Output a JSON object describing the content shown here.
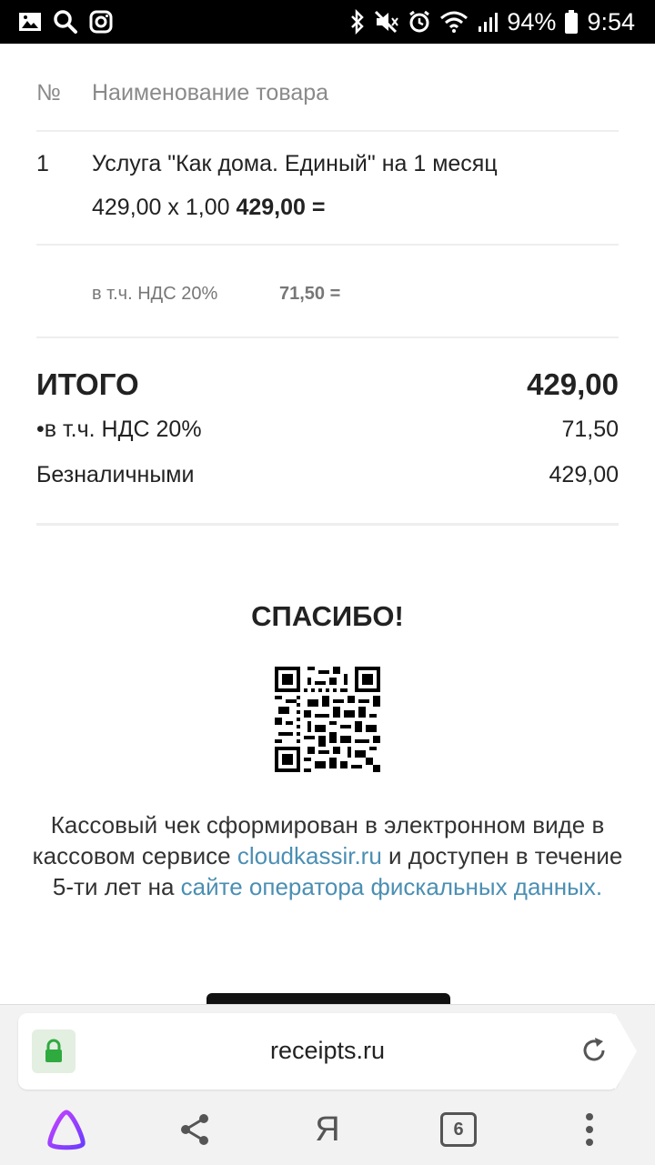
{
  "status_bar": {
    "battery_percent": "94%",
    "time": "9:54"
  },
  "receipt": {
    "header": {
      "num": "№",
      "name": "Наименование товара"
    },
    "items": [
      {
        "num": "1",
        "name": "Услуга \"Как дома. Единый\" на 1 месяц",
        "calc_prefix": "429,00 x 1,00",
        "calc_total": "429,00 ="
      }
    ],
    "item_vat": {
      "label": "в т.ч. НДС 20%",
      "value": "71,50 ="
    },
    "total": {
      "label": "ИТОГО",
      "value": "429,00"
    },
    "vat_total": {
      "label": "•в т.ч. НДС 20%",
      "value": "71,50"
    },
    "payment": {
      "label": "Безналичными",
      "value": "429,00"
    },
    "thanks": "СПАСИБО!",
    "note": {
      "part1": "Кассовый чек сформирован в электронном виде в кассовом сервисе ",
      "link1": "cloudkassir.ru",
      "part2": " и доступен в течение 5-ти лет на ",
      "link2": "сайте оператора фискальных данных."
    },
    "link_color": "#4b8fb3"
  },
  "browser": {
    "url": "receipts.ru",
    "tabs_count": "6",
    "yandex_letter": "Я",
    "secure_color": "#2eaa3f"
  }
}
